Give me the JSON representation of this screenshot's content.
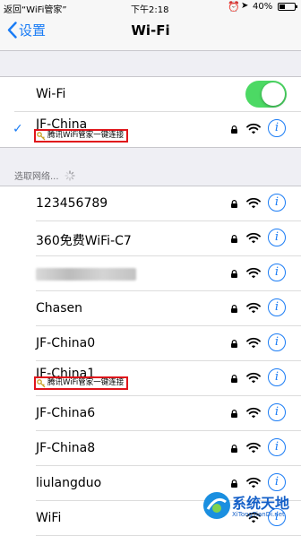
{
  "status_bar": {
    "back_app": "返回“WiFi管家”",
    "time": "下午2:18",
    "battery": "40%",
    "battery_level": 0.4
  },
  "nav": {
    "back_label": "设置",
    "title": "Wi-Fi"
  },
  "wifi_toggle": {
    "label": "Wi-Fi",
    "on": true
  },
  "connected_network": {
    "name": "JF-China",
    "tip": "腾讯WiFi管家一键连接"
  },
  "section_header": "选取网络...",
  "networks": [
    {
      "name": "123456789",
      "locked": true
    },
    {
      "name": "360免费WiFi-C7",
      "locked": true
    },
    {
      "name": "",
      "locked": true,
      "obscured": true
    },
    {
      "name": "Chasen",
      "locked": true
    },
    {
      "name": "JF-China0",
      "locked": true
    },
    {
      "name": "JF-China1",
      "locked": true,
      "tip": "腾讯WiFi管家一键连接"
    },
    {
      "name": "JF-China6",
      "locked": true
    },
    {
      "name": "JF-China8",
      "locked": true
    },
    {
      "name": "liulangduo",
      "locked": true
    },
    {
      "name": "WiFi",
      "locked": false
    }
  ],
  "info_glyph": "i",
  "check_glyph": "✓",
  "watermark": {
    "title": "系统天地",
    "subtitle": "XiTongTianDi.net"
  },
  "colors": {
    "accent": "#1a7cf5",
    "toggle_on": "#4cd964",
    "highlight_box": "#e0151b"
  }
}
